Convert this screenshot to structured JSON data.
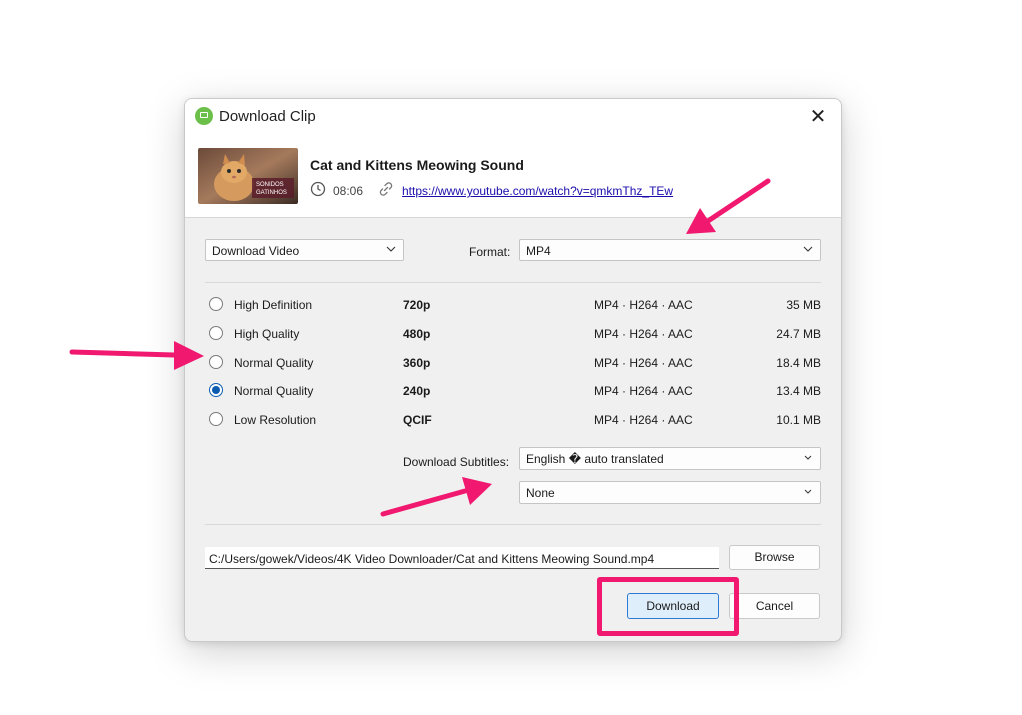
{
  "dialog": {
    "title": "Download Clip",
    "close_label": "✕"
  },
  "video": {
    "title": "Cat and Kittens Meowing Sound",
    "duration": "08:06",
    "url": "https://www.youtube.com/watch?v=qmkmThz_TEw",
    "thumb_text_1": "SONIDOS",
    "thumb_text_2": "GATINHOS"
  },
  "controls": {
    "mode_value": "Download Video",
    "format_label": "Format:",
    "format_value": "MP4"
  },
  "qualities": [
    {
      "name": "High Definition",
      "resolution": "720p",
      "format": "MP4 · H264 · AAC",
      "size": "35 MB",
      "checked": false
    },
    {
      "name": "High Quality",
      "resolution": "480p",
      "format": "MP4 · H264 · AAC",
      "size": "24.7 MB",
      "checked": false
    },
    {
      "name": "Normal Quality",
      "resolution": "360p",
      "format": "MP4 · H264 · AAC",
      "size": "18.4 MB",
      "checked": false
    },
    {
      "name": "Normal Quality",
      "resolution": "240p",
      "format": "MP4 · H264 · AAC",
      "size": "13.4 MB",
      "checked": true
    },
    {
      "name": "Low Resolution",
      "resolution": "QCIF",
      "format": "MP4 · H264 · AAC",
      "size": "10.1 MB",
      "checked": false
    }
  ],
  "subtitles": {
    "label": "Download Subtitles:",
    "primary_value": "English � auto translated",
    "secondary_value": "None"
  },
  "output": {
    "path": "C:/Users/gowek/Videos/4K Video Downloader/Cat and Kittens Meowing Sound.mp4",
    "browse_label": "Browse",
    "download_label": "Download",
    "cancel_label": "Cancel"
  },
  "colors": {
    "accent": "#0a5cb0",
    "annotation": "#f0186f",
    "link": "#1a0dab"
  },
  "icons": {
    "app": "app-logo-icon",
    "close": "close-icon",
    "clock": "clock-icon",
    "link": "link-icon",
    "chevron": "chevron-down-icon"
  }
}
